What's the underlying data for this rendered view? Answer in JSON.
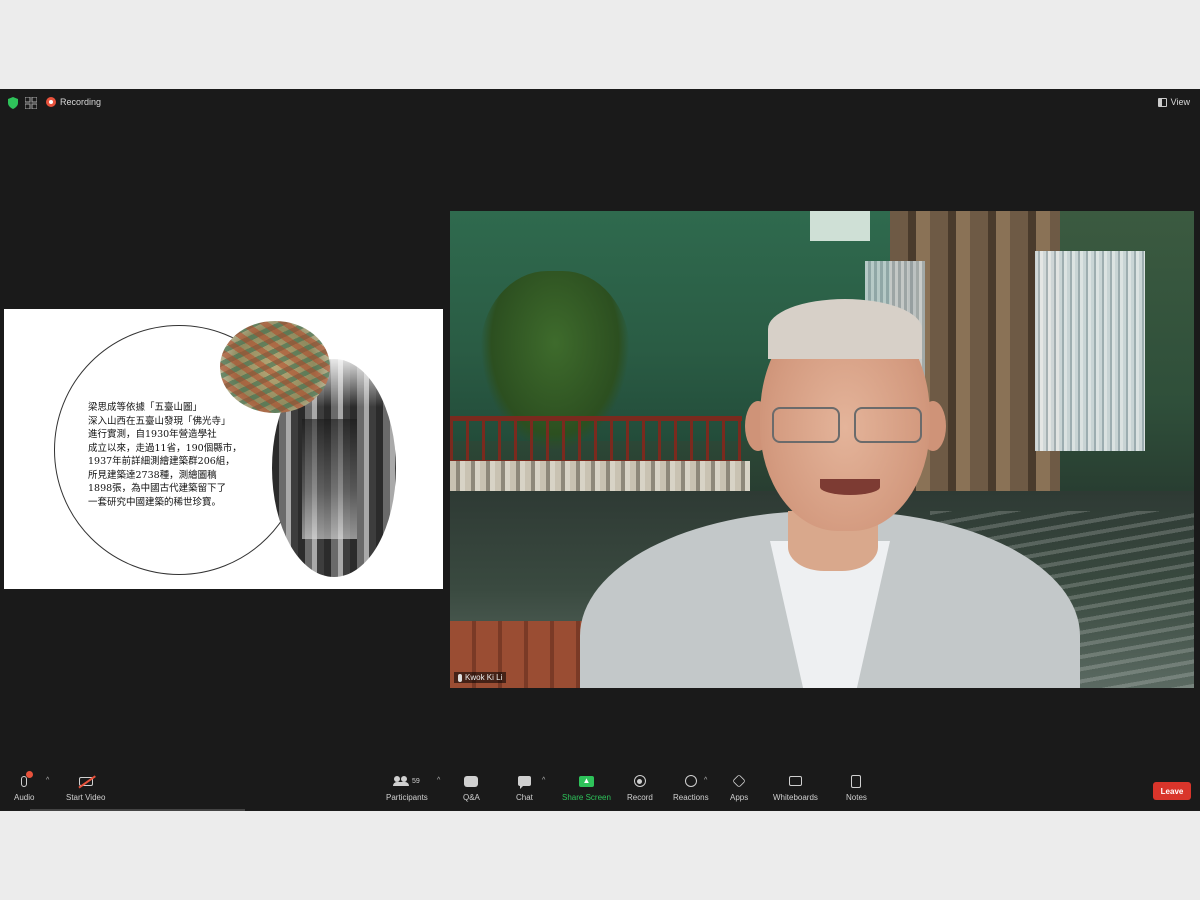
{
  "top_bar": {
    "recording_label": "Recording",
    "view_label": "View"
  },
  "slide": {
    "text_lines": [
      "梁思成等依據「五臺山圖」",
      "深入山西在五臺山發現「佛光寺」",
      "進行實測，自1930年營造學社",
      "成立以來，走過11省，190個縣市，",
      "1937年前詳細測繪建築群206組，",
      "所見建築達2738種，測繪圖稿",
      "1898張，為中國古代建築留下了",
      "一套研究中國建築的稀世珍寶。"
    ]
  },
  "video": {
    "participant_name": "Kwok Ki Li"
  },
  "toolbar": {
    "audio_label": "Audio",
    "start_video_label": "Start Video",
    "participants_label": "Participants",
    "participants_count": "59",
    "qa_label": "Q&A",
    "chat_label": "Chat",
    "share_screen_label": "Share Screen",
    "record_label": "Record",
    "reactions_label": "Reactions",
    "apps_label": "Apps",
    "whiteboards_label": "Whiteboards",
    "notes_label": "Notes",
    "leave_label": "Leave"
  },
  "colors": {
    "window_bg": "#1a1a1a",
    "share_accent": "#2ec35a",
    "leave_red": "#d9352b",
    "recording_red": "#e8523c"
  }
}
